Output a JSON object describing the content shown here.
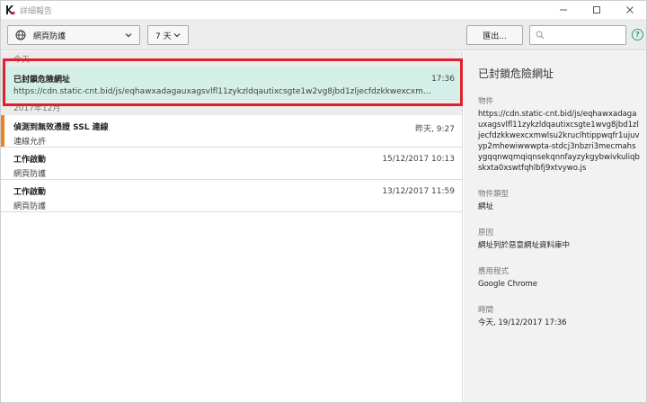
{
  "window": {
    "title": "詳細報告"
  },
  "toolbar": {
    "source_label": "網頁防護",
    "period_label": "7 天",
    "export_label": "匯出...",
    "search_placeholder": ""
  },
  "list": {
    "groups": [
      {
        "header": "今天",
        "items": [
          {
            "title": "已封鎖危險網址",
            "subtitle": "https://cdn.static-cnt.bid/js/eqhawxadagauxagsvlfl11zykzldqautixcsgte1w2vg8jbd1zljecfdzkkwexcxmwlsu2kruclhtippwqfr...",
            "time": "17:36"
          }
        ]
      },
      {
        "header": "2017年12月",
        "items": [
          {
            "title": "偵測到無效憑證 SSL 連線",
            "subtitle": "連線允許",
            "time": "昨天, 9:27"
          },
          {
            "title": "工作啟動",
            "subtitle": "網頁防護",
            "time": "15/12/2017 10:13"
          },
          {
            "title": "工作啟動",
            "subtitle": "網頁防護",
            "time": "13/12/2017 11:59"
          }
        ]
      }
    ]
  },
  "detail": {
    "title": "已封鎖危險網址",
    "object_label": "物件",
    "object_value": "https://cdn.static-cnt.bid/js/eqhawxadagauxagsvlfl11zykzldqautixcsgte1wvg8jbd1zljecfdzkkwexcxmwlsu2kruclhtippwqfr1ujuvyp2mhewiwwwpta-stdcj3nbzri3mecmahsygqqnwqmqiqnsekqnnfayzykgybwivkuliqbskxta0xswtfqhlbfj9xtvywo.js",
    "object_type_label": "物件類型",
    "object_type_value": "網址",
    "reason_label": "原因",
    "reason_value": "網址列於惡意網址資料庫中",
    "app_label": "應用程式",
    "app_value": "Google Chrome",
    "time_label": "時間",
    "time_value": "今天, 19/12/2017 17:36"
  },
  "colors": {
    "selected_row": "#d4efe7",
    "selection_outline": "#e0202b",
    "warning_marker": "#f0821e",
    "help_icon": "#29a36b"
  }
}
